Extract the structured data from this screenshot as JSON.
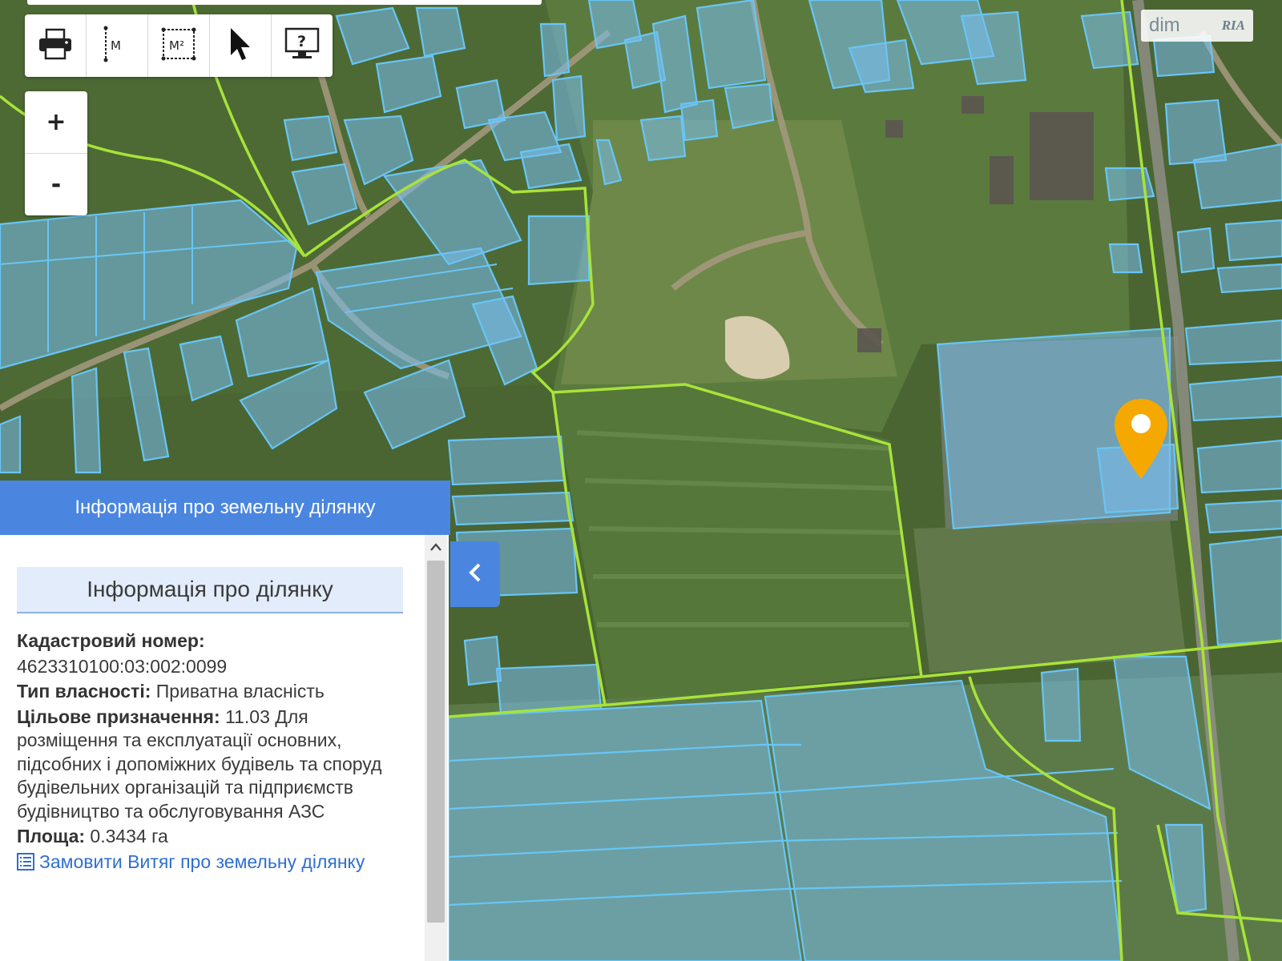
{
  "toolbar": {
    "print_icon": "printer-icon",
    "measure_length_label": "M",
    "measure_area_label": "M²",
    "select_icon": "cursor-arrow-icon",
    "help_label": "?"
  },
  "zoom": {
    "in_label": "+",
    "out_label": "-"
  },
  "watermark": {
    "brand_left": "dim",
    "brand_right": "RIA"
  },
  "colors": {
    "panel_header": "#4a86e0",
    "parcel_fill": "rgba(120,190,240,0.55)",
    "parcel_stroke": "#68c5f5",
    "boundary": "#a8e33a",
    "marker": "#f5a800"
  },
  "panel": {
    "header": "Інформація про земельну ділянку",
    "section_title": "Інформація про ділянку",
    "cadastral_label": "Кадастровий номер:",
    "cadastral_value": "4623310100:03:002:0099",
    "ownership_label": "Тип власності:",
    "ownership_value": "Приватна власність",
    "purpose_label": "Цільове призначення:",
    "purpose_value": "11.03 Для розміщення та експлуатації основних, підсобних і допоміжних будівель та споруд будівельних організацій та підприємств будівництво та обслуговування АЗС",
    "area_label": "Площа:",
    "area_value": "0.3434 га",
    "order_link": "Замовити Витяг про земельну ділянку"
  }
}
